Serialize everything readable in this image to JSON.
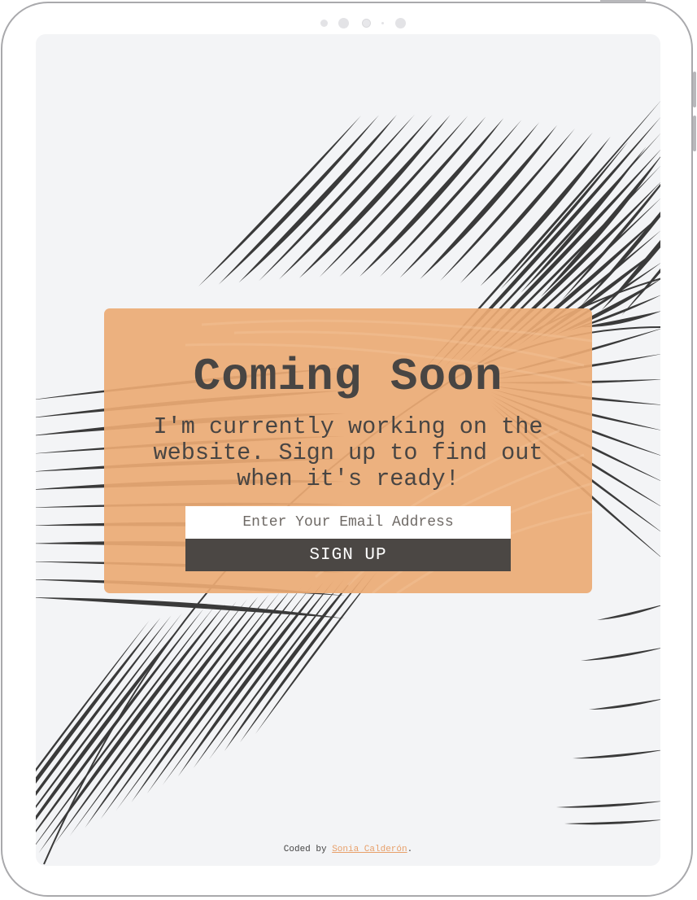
{
  "device": {
    "frame_color": "#a9a9ac",
    "screen_background": "#f3f4f6"
  },
  "hero": {
    "title": "Coming Soon",
    "subtitle": "I'm currently working on the website. Sign up to find out when it's ready!",
    "card_color": "#ecaa74"
  },
  "form": {
    "email_placeholder": "Enter Your Email Address",
    "email_value": "",
    "button_label": "SIGN UP",
    "button_color": "#4b4744"
  },
  "footer": {
    "prefix": "Coded by ",
    "author_link": "Sonia Calderón",
    "suffix": ".",
    "link_color": "#e8a06a"
  },
  "icons": {
    "background": "palm-leaf-illustration"
  }
}
